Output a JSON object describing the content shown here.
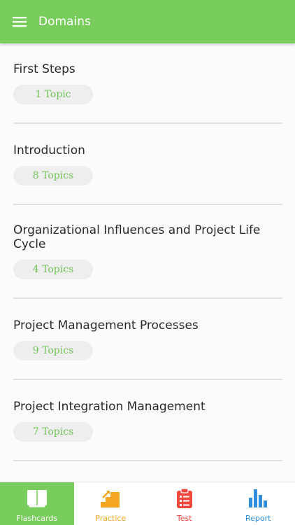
{
  "header": {
    "title": "Domains",
    "menu_icon": "hamburger-menu-icon",
    "background": "#79cd5c"
  },
  "domains": [
    {
      "title": "First Steps",
      "topics": "1 Topic"
    },
    {
      "title": "Introduction",
      "topics": "8 Topics"
    },
    {
      "title": "Organizational Influences and Project Life Cycle",
      "topics": "4 Topics"
    },
    {
      "title": "Project Management Processes",
      "topics": "9 Topics"
    },
    {
      "title": "Project Integration Management",
      "topics": "7 Topics"
    }
  ],
  "tabs": [
    {
      "label": "Flashcards",
      "icon": "flashcards-book-icon",
      "color": "#ffffff",
      "active": true
    },
    {
      "label": "Practice",
      "icon": "practice-stairs-icon",
      "color": "#f5a623",
      "active": false
    },
    {
      "label": "Test",
      "icon": "test-clipboard-icon",
      "color": "#f0473e",
      "active": false
    },
    {
      "label": "Report",
      "icon": "report-bar-chart-icon",
      "color": "#2f8fde",
      "active": false
    }
  ],
  "colors": {
    "accent": "#79cd5c",
    "topic_text": "#73c35a",
    "pill_bg": "#eeeeee"
  }
}
